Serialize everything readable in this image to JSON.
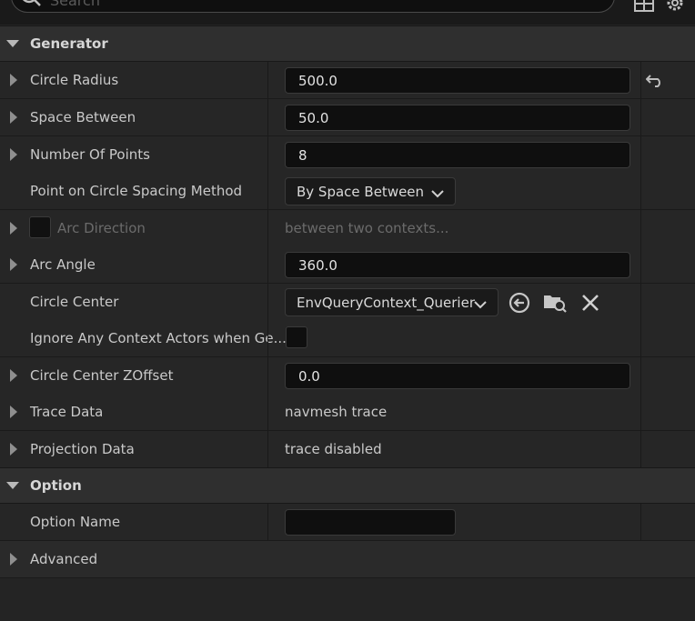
{
  "search": {
    "placeholder": "Search"
  },
  "toolbar": {
    "icons": [
      "grid-icon",
      "settings-icon"
    ]
  },
  "sections": {
    "generator": {
      "title": "Generator"
    },
    "option": {
      "title": "Option"
    }
  },
  "rows": {
    "circle_radius": {
      "label": "Circle Radius",
      "value": "500.0",
      "reset_icon": "reset-arrow-icon"
    },
    "space_between": {
      "label": "Space Between",
      "value": "50.0"
    },
    "number_of_points": {
      "label": "Number Of Points",
      "value": "8"
    },
    "spacing_method": {
      "label": "Point on Circle Spacing Method",
      "value": "By Space Between"
    },
    "arc_direction": {
      "label": "Arc Direction",
      "value": "between two contexts..."
    },
    "arc_angle": {
      "label": "Arc Angle",
      "value": "360.0"
    },
    "circle_center": {
      "label": "Circle Center",
      "value": "EnvQueryContext_Querier",
      "icons": [
        "use-selected-icon",
        "browse-icon",
        "clear-icon"
      ]
    },
    "ignore_context": {
      "label": "Ignore Any Context Actors when Ge..."
    },
    "zoffset": {
      "label": "Circle Center ZOffset",
      "value": "0.0"
    },
    "trace_data": {
      "label": "Trace Data",
      "value": "navmesh trace"
    },
    "projection_data": {
      "label": "Projection Data",
      "value": "trace disabled"
    },
    "option_name": {
      "label": "Option Name",
      "value": ""
    },
    "advanced": {
      "label": "Advanced"
    }
  },
  "colors": {
    "background": "#242424",
    "field": "#0f0f0f",
    "section": "#2f2f2f",
    "text": "#c9c9c9"
  }
}
